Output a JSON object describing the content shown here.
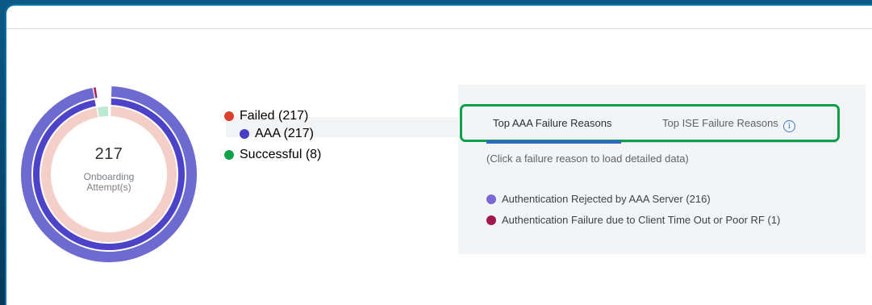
{
  "donut": {
    "count": "217",
    "label_line1": "Onboarding",
    "label_line2": "Attempt(s)",
    "outer_failed_fraction": 0.965,
    "inner_failed_fraction": 0.965,
    "inner_successful_fraction": 0.035,
    "colors": {
      "outer": "#6d6ad0",
      "inner_failed": "#4c43c8",
      "inner_pale": "#f4cfc8",
      "successful": "#bfe8d4",
      "small_marker": "#a82255"
    }
  },
  "legend": {
    "failed": {
      "label": "Failed (217)",
      "color": "#d9412b"
    },
    "aaa": {
      "label": "AAA (217)",
      "color": "#4640c4"
    },
    "successful": {
      "label": "Successful (8)",
      "color": "#12a34a"
    }
  },
  "tabs": {
    "active_label": "Top AAA Failure Reasons",
    "inactive_label": "Top ISE Failure Reasons",
    "info_icon": "info-icon"
  },
  "hint": "(Click a failure reason to load detailed data)",
  "reasons": [
    {
      "label": "Authentication Rejected by AAA Server (216)",
      "color": "#7b68d6"
    },
    {
      "label": "Authentication Failure due to Client Time Out or Poor RF (1)",
      "color": "#a3174f"
    }
  ],
  "colors": {
    "highlight": "#0aa04a",
    "accent": "#2f67c8"
  }
}
